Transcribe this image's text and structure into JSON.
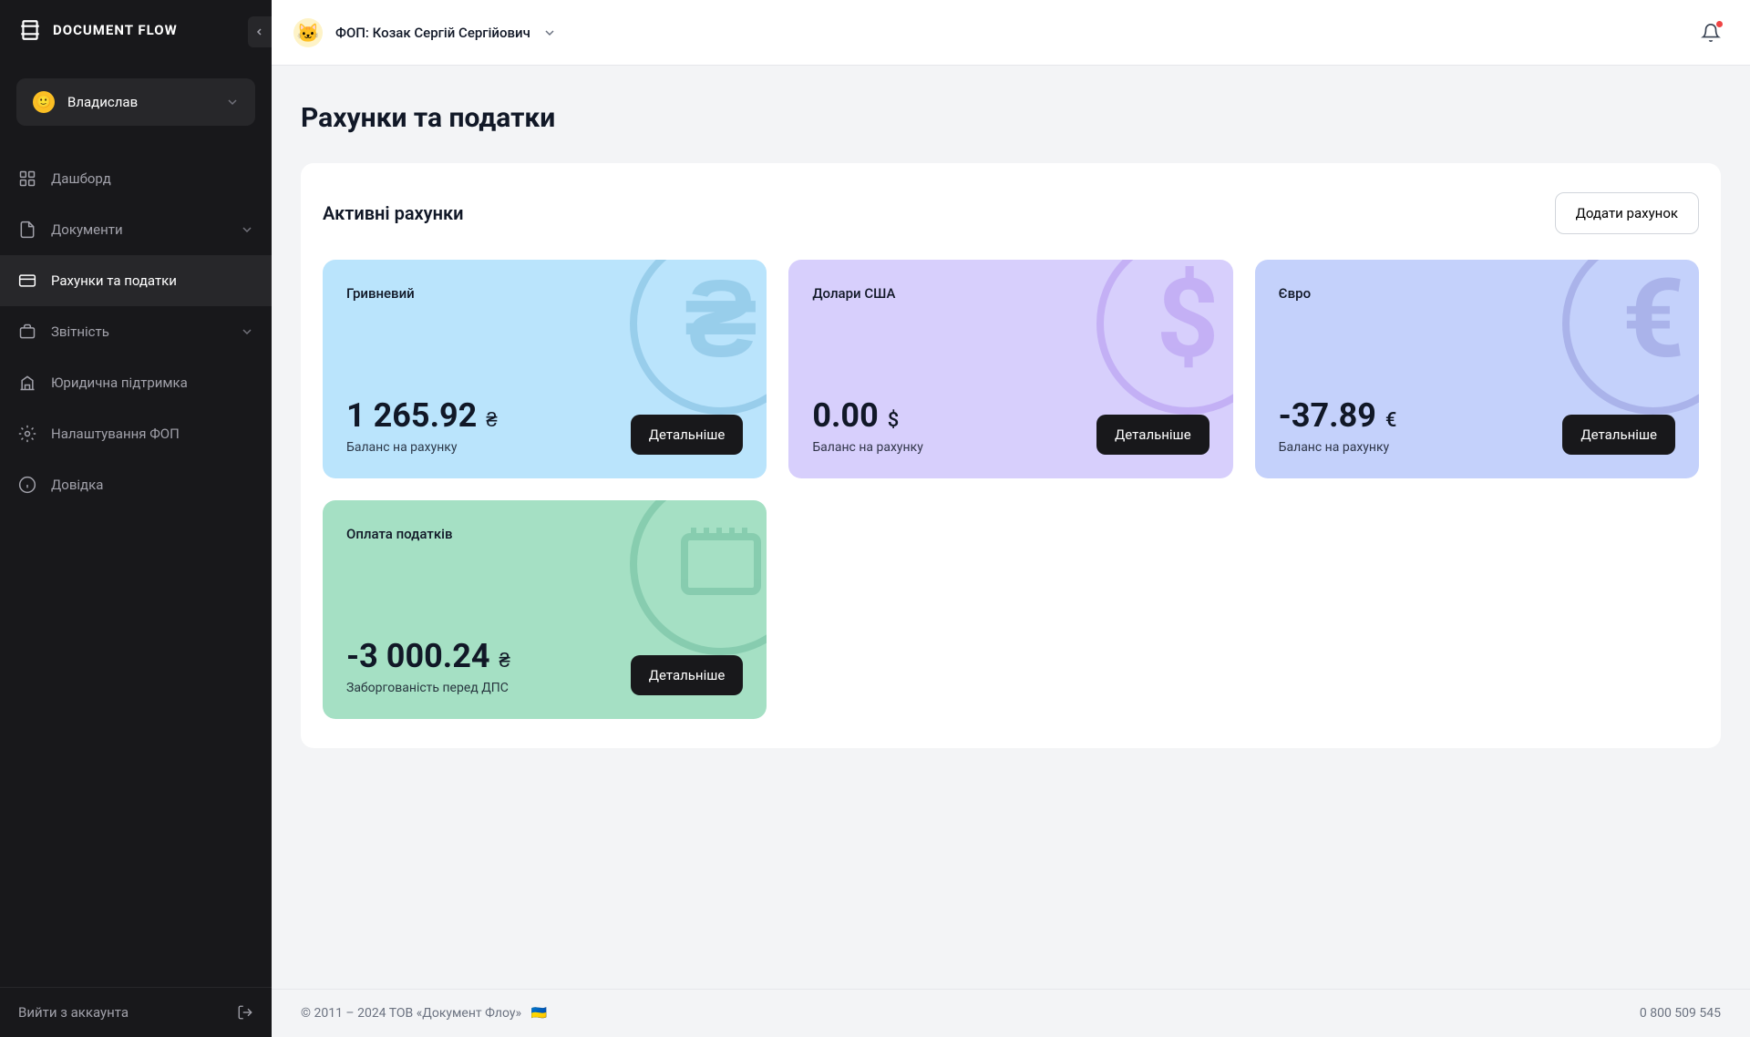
{
  "brand": "DOCUMENT FLOW",
  "user": {
    "avatar_emoji": "🙂",
    "name": "Владислав"
  },
  "nav": {
    "dashboard": "Дашборд",
    "documents": "Документи",
    "accounts": "Рахунки та податки",
    "reporting": "Звітність",
    "legal": "Юридична підтримка",
    "settings": "Налаштування ФОП",
    "help": "Довідка"
  },
  "logout_label": "Вийти з аккаунта",
  "header": {
    "entity_avatar_emoji": "🐱",
    "entity_name": "ФОП: Козак Сергій Сергійович"
  },
  "page": {
    "title": "Рахунки та податки",
    "panel_title": "Активні рахунки",
    "add_button": "Додати рахунок",
    "details_button": "Детальніше",
    "balance_label": "Баланс на рахунку",
    "debt_label": "Заборгованість перед ДПС"
  },
  "accounts": [
    {
      "name": "Гривневий",
      "amount": "1 265.92",
      "currency": "₴",
      "sublabel": "Баланс на рахунку"
    },
    {
      "name": "Долари США",
      "amount": "0.00",
      "currency": "$",
      "sublabel": "Баланс на рахунку"
    },
    {
      "name": "Євро",
      "amount": "-37.89",
      "currency": "€",
      "sublabel": "Баланс на рахунку"
    },
    {
      "name": "Оплата податків",
      "amount": "-3 000.24",
      "currency": "₴",
      "sublabel": "Заборгованість перед ДПС"
    }
  ],
  "footer": {
    "copyright": "© 2011 – 2024 ТОВ «Документ Флоу»",
    "flag": "🇺🇦",
    "phone": "0 800 509 545"
  }
}
